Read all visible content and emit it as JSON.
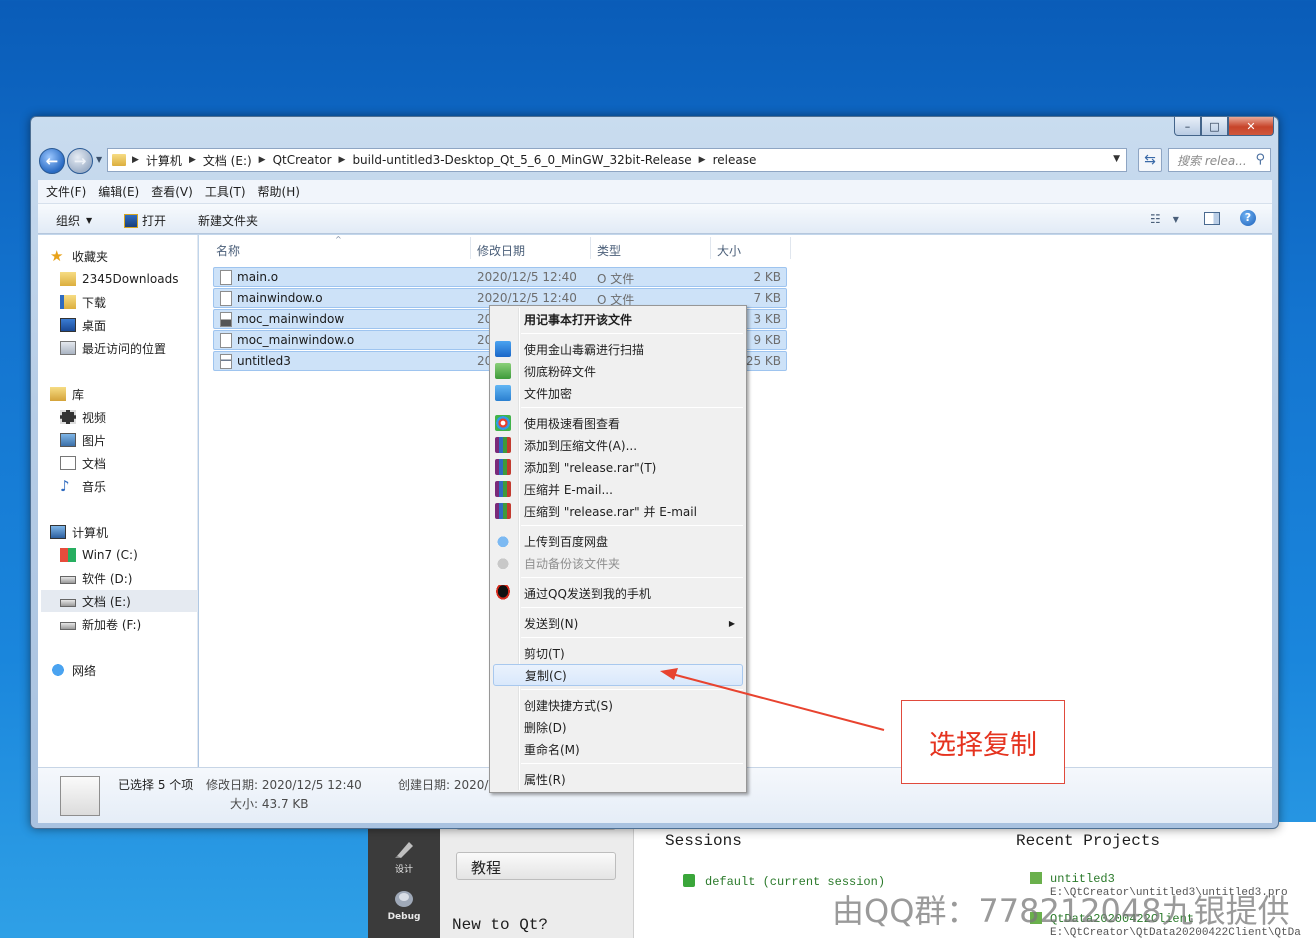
{
  "window": {
    "address_path": [
      "计算机",
      "文档 (E:)",
      "QtCreator",
      "build-untitled3-Desktop_Qt_5_6_0_MinGW_32bit-Release",
      "release"
    ],
    "search_placeholder": "搜索 relea...",
    "controls": {
      "minimize": "–",
      "maximize": "□",
      "close": "✕"
    }
  },
  "menubar": [
    "文件(F)",
    "编辑(E)",
    "查看(V)",
    "工具(T)",
    "帮助(H)"
  ],
  "commandbar": {
    "organize": "组织",
    "open": "打开",
    "new_folder": "新建文件夹"
  },
  "nav_pane": {
    "favorites": {
      "label": "收藏夹",
      "items": [
        "2345Downloads",
        "下载",
        "桌面",
        "最近访问的位置"
      ]
    },
    "libraries": {
      "label": "库",
      "items": [
        "视频",
        "图片",
        "文档",
        "音乐"
      ]
    },
    "computer": {
      "label": "计算机",
      "items": [
        "Win7 (C:)",
        "软件 (D:)",
        "文档 (E:)",
        "新加卷 (F:)"
      ]
    },
    "network": {
      "label": "网络"
    }
  },
  "columns": {
    "name": "名称",
    "date": "修改日期",
    "type": "类型",
    "size": "大小"
  },
  "files": [
    {
      "name": "main.o",
      "date": "2020/12/5 12:40",
      "type": "O 文件",
      "size": "2 KB"
    },
    {
      "name": "mainwindow.o",
      "date": "2020/12/5 12:40",
      "type": "O 文件",
      "size": "7 KB"
    },
    {
      "name": "moc_mainwindow",
      "date": "20",
      "type": "",
      "size": "3 KB"
    },
    {
      "name": "moc_mainwindow.o",
      "date": "20",
      "type": "",
      "size": "9 KB"
    },
    {
      "name": "untitled3",
      "date": "20",
      "type": "",
      "size": "25 KB"
    }
  ],
  "details": {
    "selected": "已选择 5 个项",
    "modified": "修改日期: 2020/12/5 12:40",
    "size": "大小: 43.7 KB",
    "created": "创建日期: 2020/1"
  },
  "context_menu": {
    "open_notepad": "用记事本打开该文件",
    "scan": "使用金山毒霸进行扫描",
    "shred": "彻底粉碎文件",
    "encrypt": "文件加密",
    "fast_view": "使用极速看图查看",
    "add_archive": "添加到压缩文件(A)...",
    "add_release_rar": "添加到 \"release.rar\"(T)",
    "compress_email": "压缩并 E-mail...",
    "compress_release_email": "压缩到 \"release.rar\" 并 E-mail",
    "upload_baidu": "上传到百度网盘",
    "auto_backup": "自动备份该文件夹",
    "send_qq": "通过QQ发送到我的手机",
    "send_to": "发送到(N)",
    "cut": "剪切(T)",
    "copy": "复制(C)",
    "create_shortcut": "创建快捷方式(S)",
    "delete": "删除(D)",
    "rename": "重命名(M)",
    "properties": "属性(R)"
  },
  "annotation": {
    "text": "选择复制",
    "color": "#e5331f"
  },
  "qt_creator": {
    "mode_design": "设计",
    "mode_debug": "Debug",
    "btn_tutorial": "教程",
    "new_to_qt": "New to Qt?",
    "sessions_title": "Sessions",
    "session_default": "default (current session)",
    "recent_title": "Recent Projects",
    "recent": [
      {
        "name": "untitled3",
        "path": "E:\\QtCreator\\untitled3\\untitled3.pro"
      },
      {
        "name": "QtData20200422Client",
        "path": "E:\\QtCreator\\QtData20200422Client\\QtDa"
      }
    ]
  },
  "watermark": "由QQ群：778212048九银提供"
}
